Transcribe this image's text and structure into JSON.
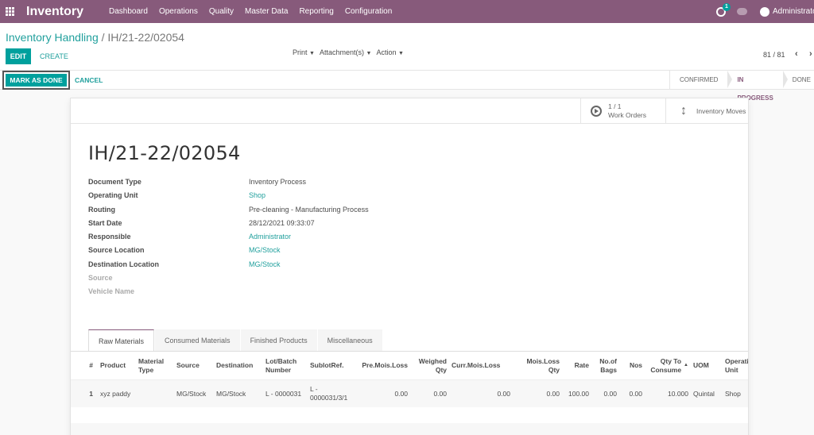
{
  "navbar": {
    "app_name": "Inventory",
    "menu": [
      "Dashboard",
      "Operations",
      "Quality",
      "Master Data",
      "Reporting",
      "Configuration"
    ],
    "activity_count": "1",
    "user": "Administrator",
    "bg_color": "#875a7b"
  },
  "control_panel": {
    "breadcrumb_parent": "Inventory Handling",
    "breadcrumb_separator": "/",
    "breadcrumb_current": "IH/21-22/02054",
    "edit_label": "EDIT",
    "create_label": "CREATE",
    "dropdowns": [
      "Print",
      "Attachment(s)",
      "Action"
    ],
    "pager": "81 / 81",
    "pager_prev": "‹",
    "pager_next": "›"
  },
  "statusbar": {
    "mark_done_label": "MARK AS DONE",
    "cancel_label": "CANCEL",
    "stages": [
      {
        "label": "CONFIRMED",
        "active": false
      },
      {
        "label": "IN PROGRESS",
        "active": true
      },
      {
        "label": "DONE",
        "active": false
      }
    ],
    "accent_color": "#00a09d"
  },
  "smart_buttons": {
    "work_orders_count": "1 / 1",
    "work_orders_label": "Work Orders",
    "inventory_moves_label": "Inventory Moves"
  },
  "document": {
    "title": "IH/21-22/02054",
    "fields": [
      {
        "label": "Document Type",
        "value": "Inventory Process",
        "link": false,
        "muted": false
      },
      {
        "label": "Operating Unit",
        "value": "Shop",
        "link": true,
        "muted": false
      },
      {
        "label": "Routing",
        "value": "Pre-cleaning - Manufacturing Process",
        "link": false,
        "muted": false
      },
      {
        "label": "Start Date",
        "value": "28/12/2021 09:33:07",
        "link": false,
        "muted": false
      },
      {
        "label": "Responsible",
        "value": "Administrator",
        "link": true,
        "muted": false
      },
      {
        "label": "Source Location",
        "value": "MG/Stock",
        "link": true,
        "muted": false
      },
      {
        "label": "Destination Location",
        "value": "MG/Stock",
        "link": true,
        "muted": false
      },
      {
        "label": "Source",
        "value": "",
        "link": false,
        "muted": true
      },
      {
        "label": "Vehicle Name",
        "value": "",
        "link": false,
        "muted": true
      }
    ]
  },
  "tabs": [
    {
      "label": "Raw Materials",
      "active": true
    },
    {
      "label": "Consumed Materials",
      "active": false
    },
    {
      "label": "Finished Products",
      "active": false
    },
    {
      "label": "Miscellaneous",
      "active": false
    }
  ],
  "table": {
    "headers": [
      "#",
      "Product",
      "Material Type",
      "Source",
      "Destination",
      "Lot/Batch Number",
      "SublotRef.",
      "Pre.Mois.Loss",
      "Weighed Qty",
      "Curr.Mois.Loss",
      "Mois.Loss Qty",
      "Rate",
      "No.of Bags",
      "Nos",
      "Qty To Consume",
      "UOM",
      "Operating Unit"
    ],
    "sorted_column": "Qty To Consume",
    "rows": [
      [
        "1",
        "xyz paddy",
        "",
        "MG/Stock",
        "MG/Stock",
        "L - 0000031",
        "L - 0000031/3/1",
        "0.00",
        "0.00",
        "0.00",
        "0.00",
        "100.00",
        "0.00",
        "0.00",
        "10.000",
        "Quintal",
        "Shop"
      ]
    ]
  }
}
